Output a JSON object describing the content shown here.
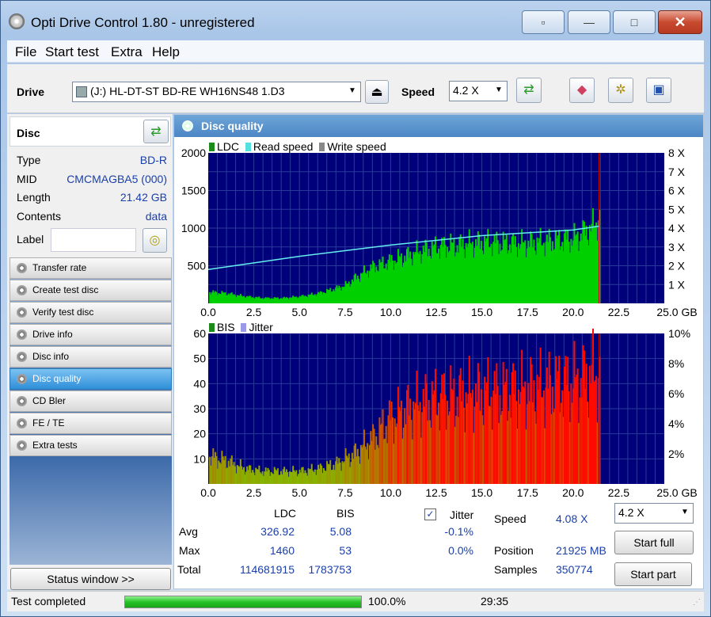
{
  "window": {
    "title": "Opti Drive Control 1.80 - unregistered"
  },
  "menu": [
    "File",
    "Start test",
    "Extra",
    "Help"
  ],
  "toolbar": {
    "drive_label": "Drive",
    "drive_value": "(J:)   HL-DT-ST BD-RE  WH16NS48 1.D3",
    "speed_label": "Speed",
    "speed_value": "4.2 X"
  },
  "disc": {
    "title": "Disc",
    "rows": [
      {
        "key": "Type",
        "value": "BD-R"
      },
      {
        "key": "MID",
        "value": "CMCMAGBA5 (000)"
      },
      {
        "key": "Length",
        "value": "21.42 GB"
      },
      {
        "key": "Contents",
        "value": "data"
      },
      {
        "key": "Label",
        "value": ""
      }
    ]
  },
  "nav": [
    {
      "label": "Transfer rate",
      "active": false
    },
    {
      "label": "Create test disc",
      "active": false
    },
    {
      "label": "Verify test disc",
      "active": false
    },
    {
      "label": "Drive info",
      "active": false
    },
    {
      "label": "Disc info",
      "active": false
    },
    {
      "label": "Disc quality",
      "active": true
    },
    {
      "label": "CD Bler",
      "active": false
    },
    {
      "label": "FE / TE",
      "active": false
    },
    {
      "label": "Extra tests",
      "active": false
    }
  ],
  "status_window_label": "Status window >>",
  "panel_title": "Disc quality",
  "chart_data": [
    {
      "type": "area",
      "legend": [
        "LDC",
        "Read speed",
        "Write speed"
      ],
      "x_ticks": [
        "0.0",
        "2.5",
        "5.0",
        "7.5",
        "10.0",
        "12.5",
        "15.0",
        "17.5",
        "20.0",
        "22.5",
        "25.0 GB"
      ],
      "y_left_ticks": [
        "2000",
        "1500",
        "1000",
        "500"
      ],
      "y_right_ticks": [
        "8 X",
        "7 X",
        "6 X",
        "5 X",
        "4 X",
        "3 X",
        "2 X",
        "1 X"
      ],
      "xlim": [
        0,
        25
      ],
      "ylim": [
        0,
        2000
      ],
      "y2lim": [
        0,
        8
      ],
      "series": [
        {
          "name": "LDC",
          "color": "#00cc00",
          "x": [
            0,
            1,
            2,
            3,
            4,
            5,
            6,
            7,
            7.5,
            8,
            9,
            10,
            11,
            12,
            13,
            14,
            15,
            16,
            17,
            18,
            19,
            20,
            21,
            21.42
          ],
          "values": [
            150,
            130,
            90,
            70,
            70,
            90,
            130,
            200,
            240,
            330,
            480,
            560,
            640,
            720,
            760,
            780,
            810,
            800,
            790,
            810,
            830,
            860,
            1000,
            1150
          ]
        },
        {
          "name": "Read speed",
          "color": "#55dddd",
          "x": [
            0,
            5,
            10,
            15,
            20,
            21.42
          ],
          "values": [
            1.8,
            2.5,
            3.1,
            3.6,
            3.9,
            4.1
          ]
        }
      ]
    },
    {
      "type": "bar",
      "legend": [
        "BIS",
        "Jitter"
      ],
      "x_ticks": [
        "0.0",
        "2.5",
        "5.0",
        "7.5",
        "10.0",
        "12.5",
        "15.0",
        "17.5",
        "20.0",
        "22.5",
        "25.0 GB"
      ],
      "y_left_ticks": [
        "60",
        "50",
        "40",
        "30",
        "20",
        "10"
      ],
      "y_right_ticks": [
        "10%",
        "8%",
        "6%",
        "4%",
        "2%"
      ],
      "xlim": [
        0,
        25
      ],
      "ylim": [
        0,
        60
      ],
      "series": [
        {
          "name": "BIS",
          "x": [
            0,
            1,
            2,
            3,
            4,
            5,
            6,
            7,
            8,
            9,
            10,
            11,
            12,
            13,
            14,
            15,
            16,
            17,
            18,
            19,
            20,
            21,
            21.42
          ],
          "values": [
            11,
            9,
            6,
            5,
            5,
            5,
            6,
            8,
            12,
            18,
            26,
            30,
            33,
            34,
            35,
            36,
            36,
            37,
            38,
            39,
            40,
            43,
            44
          ]
        }
      ]
    }
  ],
  "stats": {
    "col_ldc": "LDC",
    "col_bis": "BIS",
    "col_jitter": "Jitter",
    "rows": [
      {
        "label": "Avg",
        "ldc": "326.92",
        "bis": "5.08",
        "jitter": "-0.1%"
      },
      {
        "label": "Max",
        "ldc": "1460",
        "bis": "53",
        "jitter": "0.0%"
      },
      {
        "label": "Total",
        "ldc": "114681915",
        "bis": "1783753",
        "jitter": ""
      }
    ],
    "speed_label": "Speed",
    "speed_value": "4.08 X",
    "position_label": "Position",
    "position_value": "21925 MB",
    "samples_label": "Samples",
    "samples_value": "350774",
    "speed_select": "4.2 X",
    "start_full": "Start full",
    "start_part": "Start part"
  },
  "status": {
    "text": "Test completed",
    "progress": 1.0,
    "progress_text": "100.0%",
    "time": "29:35"
  }
}
